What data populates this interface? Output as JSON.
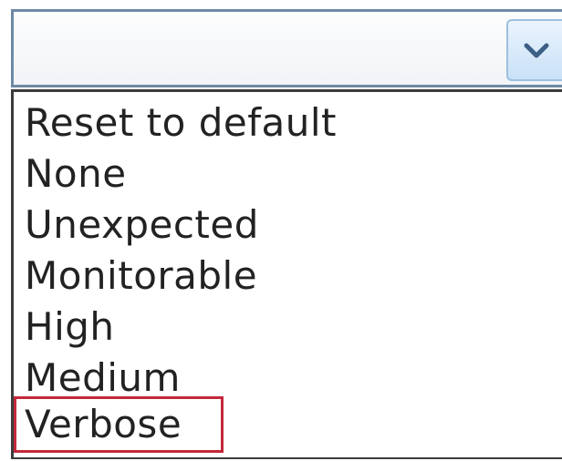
{
  "combo": {
    "value": "",
    "arrow_icon": "chevron-down-icon",
    "arrow_color": "#3c5f86"
  },
  "dropdown": {
    "options": [
      "Reset to default",
      "None",
      "Unexpected",
      "Monitorable",
      "High",
      "Medium",
      "Verbose"
    ],
    "highlighted_option": "Verbose",
    "highlight_color": "#c3283a"
  }
}
